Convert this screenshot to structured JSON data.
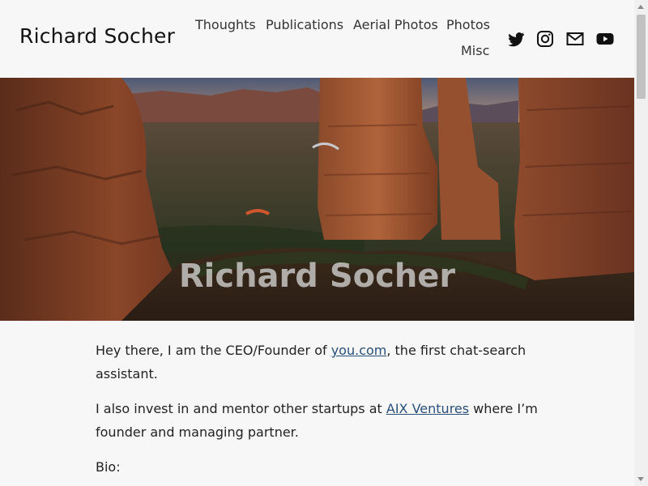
{
  "header": {
    "site_title": "Richard Socher",
    "nav": [
      {
        "label": "Thoughts"
      },
      {
        "label": "Publications"
      },
      {
        "label": "Aerial Photos"
      },
      {
        "label": "Photos"
      },
      {
        "label": "Misc"
      }
    ],
    "social_icons": [
      "twitter-icon",
      "instagram-icon",
      "email-icon",
      "youtube-icon"
    ]
  },
  "hero": {
    "title": "Richard Socher"
  },
  "content": {
    "intro_prefix": "Hey there,  I am the CEO/Founder of ",
    "intro_link": "you.com",
    "intro_suffix": ", the first chat-search assistant.",
    "invest_prefix": "I also invest in and mentor other startups at ",
    "invest_link": "AIX Ventures",
    "invest_suffix": " where I’m founder and managing partner.",
    "bio_label": "Bio:"
  },
  "colors": {
    "background": "#f7f7f7",
    "link": "#2a4f7a",
    "text": "#222222"
  }
}
